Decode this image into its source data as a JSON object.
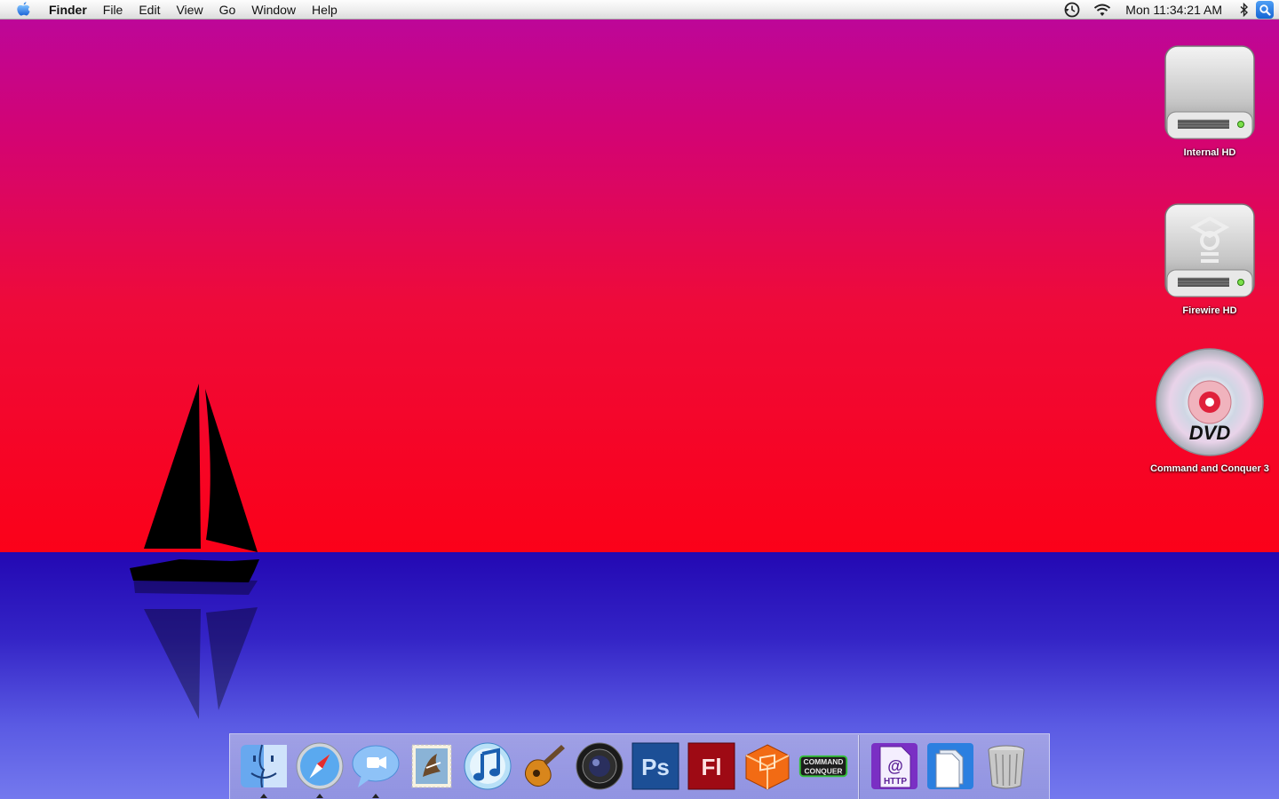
{
  "menubar": {
    "apple_icon": "apple-icon",
    "app_name": "Finder",
    "menus": [
      "File",
      "Edit",
      "View",
      "Go",
      "Window",
      "Help"
    ],
    "clock": "Mon 11:34:21 AM",
    "status_icons": [
      "timemachine-icon",
      "wifi-icon",
      "bluetooth-icon",
      "spotlight-icon"
    ]
  },
  "desktop": {
    "icons": [
      {
        "label": "Internal HD",
        "icon": "internal-hd-icon"
      },
      {
        "label": "Firewire HD",
        "icon": "firewire-hd-icon"
      },
      {
        "label": "Command and Conquer 3",
        "icon": "dvd-icon",
        "disc_text": "DVD"
      }
    ],
    "colors": {
      "sky_top": "#b9069f",
      "sky_bottom": "#fb0119",
      "sea_top": "#2308b3",
      "sea_bottom": "#7479ee"
    }
  },
  "dock": {
    "apps": [
      {
        "name": "finder",
        "icon": "finder-icon",
        "running": true
      },
      {
        "name": "safari",
        "icon": "safari-compass-icon",
        "running": true
      },
      {
        "name": "ichat",
        "icon": "ichat-bubble-icon",
        "running": true
      },
      {
        "name": "mail",
        "icon": "mail-stamp-icon",
        "running": false
      },
      {
        "name": "itunes",
        "icon": "itunes-note-icon",
        "running": false
      },
      {
        "name": "garageband",
        "icon": "guitar-icon",
        "running": false
      },
      {
        "name": "aperture",
        "icon": "camera-lens-icon",
        "running": false
      },
      {
        "name": "photoshop",
        "icon": "photoshop-icon",
        "running": false,
        "text": "Ps"
      },
      {
        "name": "flash",
        "icon": "flash-icon",
        "running": false,
        "text": "Fl"
      },
      {
        "name": "package",
        "icon": "orange-cube-icon",
        "running": false
      },
      {
        "name": "command-and-conquer",
        "icon": "cnc-logo-icon",
        "running": false,
        "text_top": "COMMAND",
        "text_bottom": "CONQUER"
      }
    ],
    "docs": [
      {
        "name": "web-location",
        "icon": "http-document-icon",
        "text_at": "@",
        "text_http": "HTTP"
      },
      {
        "name": "documents",
        "icon": "documents-stack-icon"
      },
      {
        "name": "trash",
        "icon": "trash-icon"
      }
    ]
  }
}
